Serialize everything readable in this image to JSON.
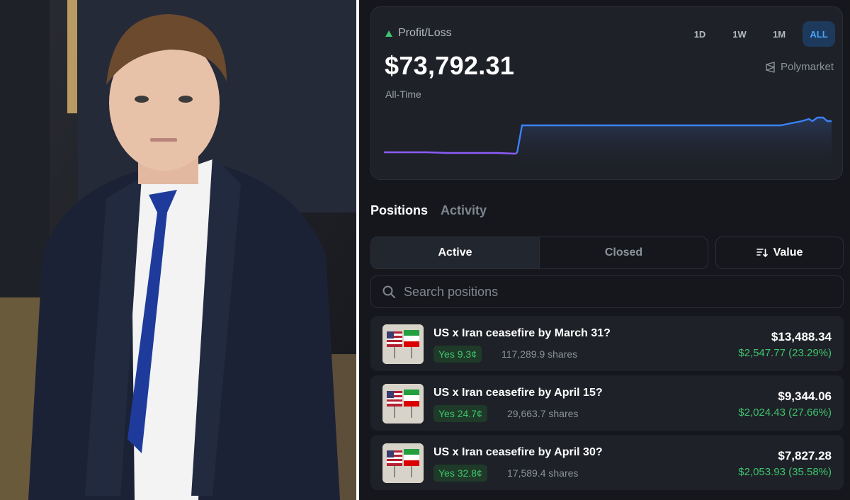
{
  "profit_loss": {
    "label": "Profit/Loss",
    "value": "$73,792.31",
    "period": "All-Time",
    "ranges": [
      "1D",
      "1W",
      "1M",
      "ALL"
    ],
    "active_range": "ALL",
    "brand": "Polymarket",
    "colors": {
      "positive": "#3ec46d",
      "line_before": "#8b5cf6",
      "line_after": "#3b82f6",
      "accent": "#4aa3ff"
    }
  },
  "tabs": {
    "positions": "Positions",
    "activity": "Activity"
  },
  "filters": {
    "active": "Active",
    "closed": "Closed",
    "sort": "Value"
  },
  "search": {
    "placeholder": "Search positions"
  },
  "positions": [
    {
      "title": "US x Iran ceasefire by March 31?",
      "outcome": "Yes 9.3¢",
      "shares": "117,289.9 shares",
      "value": "$13,488.34",
      "gain": "$2,547.77 (23.29%)"
    },
    {
      "title": "US x Iran ceasefire by April 15?",
      "outcome": "Yes 24.7¢",
      "shares": "29,663.7 shares",
      "value": "$9,344.06",
      "gain": "$2,024.43 (27.66%)"
    },
    {
      "title": "US x Iran ceasefire by April 30?",
      "outcome": "Yes 32.8¢",
      "shares": "17,589.4 shares",
      "value": "$7,827.28",
      "gain": "$2,053.93 (35.58%)"
    }
  ]
}
